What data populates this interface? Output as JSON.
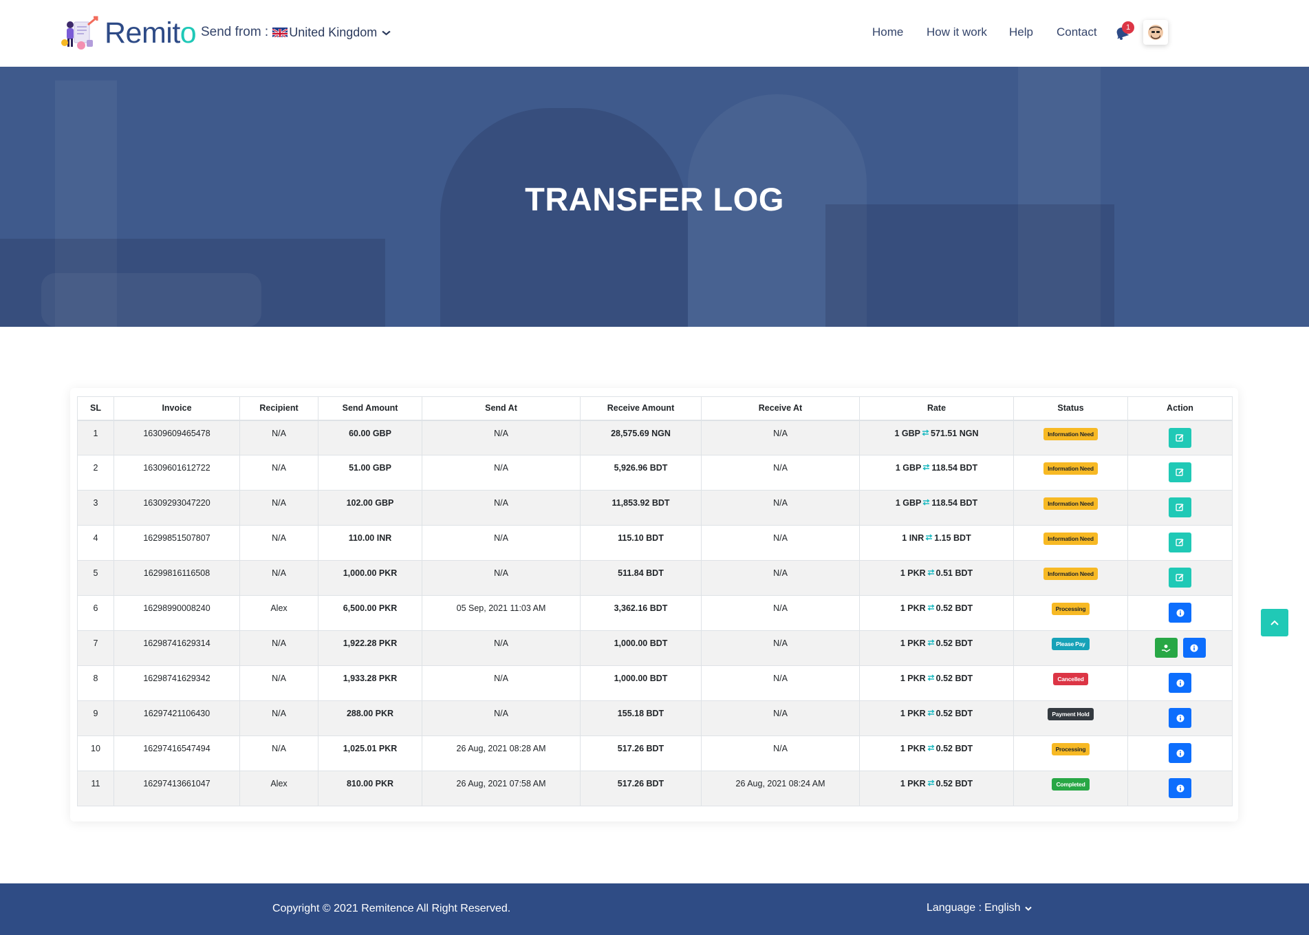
{
  "header": {
    "logo_text_main": "Remit",
    "logo_text_accent": "o",
    "send_from_label": "Send from :",
    "send_from_country": "United Kingdom",
    "nav": [
      {
        "label": "Home"
      },
      {
        "label": "How it work"
      },
      {
        "label": "Help"
      },
      {
        "label": "Contact"
      }
    ],
    "notification_count": "1"
  },
  "banner": {
    "title": "TRANSFER LOG"
  },
  "table": {
    "columns": [
      "SL",
      "Invoice",
      "Recipient",
      "Send Amount",
      "Send At",
      "Receive Amount",
      "Receive At",
      "Rate",
      "Status",
      "Action"
    ],
    "rows": [
      {
        "sl": "1",
        "invoice": "16309609465478",
        "recipient": "N/A",
        "send_amount": "60.00 GBP",
        "send_at": "N/A",
        "receive_amount": "28,575.69 NGN",
        "receive_at": "N/A",
        "rate_from": "1 GBP",
        "rate_to": "571.51 NGN",
        "status": "Information Need",
        "status_type": "info",
        "actions": [
          "edit"
        ]
      },
      {
        "sl": "2",
        "invoice": "16309601612722",
        "recipient": "N/A",
        "send_amount": "51.00 GBP",
        "send_at": "N/A",
        "receive_amount": "5,926.96 BDT",
        "receive_at": "N/A",
        "rate_from": "1 GBP",
        "rate_to": "118.54 BDT",
        "status": "Information Need",
        "status_type": "info",
        "actions": [
          "edit"
        ]
      },
      {
        "sl": "3",
        "invoice": "16309293047220",
        "recipient": "N/A",
        "send_amount": "102.00 GBP",
        "send_at": "N/A",
        "receive_amount": "11,853.92 BDT",
        "receive_at": "N/A",
        "rate_from": "1 GBP",
        "rate_to": "118.54 BDT",
        "status": "Information Need",
        "status_type": "info",
        "actions": [
          "edit"
        ]
      },
      {
        "sl": "4",
        "invoice": "16299851507807",
        "recipient": "N/A",
        "send_amount": "110.00 INR",
        "send_at": "N/A",
        "receive_amount": "115.10 BDT",
        "receive_at": "N/A",
        "rate_from": "1 INR",
        "rate_to": "1.15 BDT",
        "status": "Information Need",
        "status_type": "info",
        "actions": [
          "edit"
        ]
      },
      {
        "sl": "5",
        "invoice": "16299816116508",
        "recipient": "N/A",
        "send_amount": "1,000.00 PKR",
        "send_at": "N/A",
        "receive_amount": "511.84 BDT",
        "receive_at": "N/A",
        "rate_from": "1 PKR",
        "rate_to": "0.51 BDT",
        "status": "Information Need",
        "status_type": "info",
        "actions": [
          "edit"
        ]
      },
      {
        "sl": "6",
        "invoice": "16298990008240",
        "recipient": "Alex",
        "send_amount": "6,500.00 PKR",
        "send_at": "05 Sep, 2021 11:03 AM",
        "receive_amount": "3,362.16 BDT",
        "receive_at": "N/A",
        "rate_from": "1 PKR",
        "rate_to": "0.52 BDT",
        "status": "Processing",
        "status_type": "proc",
        "actions": [
          "details"
        ]
      },
      {
        "sl": "7",
        "invoice": "16298741629314",
        "recipient": "N/A",
        "send_amount": "1,922.28 PKR",
        "send_at": "N/A",
        "receive_amount": "1,000.00 BDT",
        "receive_at": "N/A",
        "rate_from": "1 PKR",
        "rate_to": "0.52 BDT",
        "status": "Please Pay",
        "status_type": "pay",
        "actions": [
          "pay",
          "details"
        ]
      },
      {
        "sl": "8",
        "invoice": "16298741629342",
        "recipient": "N/A",
        "send_amount": "1,933.28 PKR",
        "send_at": "N/A",
        "receive_amount": "1,000.00 BDT",
        "receive_at": "N/A",
        "rate_from": "1 PKR",
        "rate_to": "0.52 BDT",
        "status": "Cancelled",
        "status_type": "cancel",
        "actions": [
          "details"
        ]
      },
      {
        "sl": "9",
        "invoice": "16297421106430",
        "recipient": "N/A",
        "send_amount": "288.00 PKR",
        "send_at": "N/A",
        "receive_amount": "155.18 BDT",
        "receive_at": "N/A",
        "rate_from": "1 PKR",
        "rate_to": "0.52 BDT",
        "status": "Payment Hold",
        "status_type": "hold",
        "actions": [
          "details"
        ]
      },
      {
        "sl": "10",
        "invoice": "16297416547494",
        "recipient": "N/A",
        "send_amount": "1,025.01 PKR",
        "send_at": "26 Aug, 2021 08:28 AM",
        "receive_amount": "517.26 BDT",
        "receive_at": "N/A",
        "rate_from": "1 PKR",
        "rate_to": "0.52 BDT",
        "status": "Processing",
        "status_type": "proc",
        "actions": [
          "details"
        ]
      },
      {
        "sl": "11",
        "invoice": "16297413661047",
        "recipient": "Alex",
        "send_amount": "810.00 PKR",
        "send_at": "26 Aug, 2021 07:58 AM",
        "receive_amount": "517.26 BDT",
        "receive_at": "26 Aug, 2021 08:24 AM",
        "rate_from": "1 PKR",
        "rate_to": "0.52 BDT",
        "status": "Completed",
        "status_type": "done",
        "actions": [
          "details"
        ]
      }
    ]
  },
  "footer": {
    "copyright": "Copyright © 2021 Remitence All Right Reserved.",
    "language_label": "Language :",
    "language_value": "English"
  },
  "colors": {
    "brand_navy": "#2d4a86",
    "brand_teal": "#1fc8b7",
    "banner_bg": "#3f5a8c",
    "footer_bg": "#2f4c85"
  },
  "icons": {
    "edit": "edit-icon",
    "details": "info-circle-icon",
    "pay": "pay-hand-icon",
    "rate": "exchange-arrows-icon",
    "notification": "bell-icon",
    "scroll_top": "chevron-up-icon"
  }
}
